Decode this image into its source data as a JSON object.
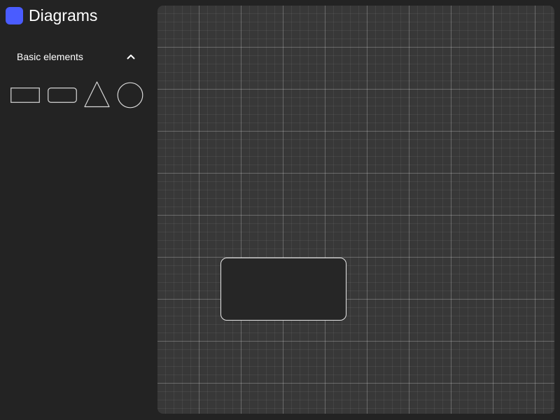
{
  "app": {
    "title": "Diagrams",
    "logo_color": "#4a5cff"
  },
  "sidebar": {
    "section": {
      "title": "Basic elements",
      "expanded": true,
      "toggle_icon": "chevron-up-icon"
    },
    "shapes": [
      {
        "name": "rectangle"
      },
      {
        "name": "rounded-rectangle"
      },
      {
        "name": "triangle"
      },
      {
        "name": "circle"
      }
    ]
  },
  "canvas": {
    "background": "#383838",
    "grid": true,
    "nodes": [
      {
        "shape": "rounded-rectangle",
        "label": ""
      }
    ]
  }
}
